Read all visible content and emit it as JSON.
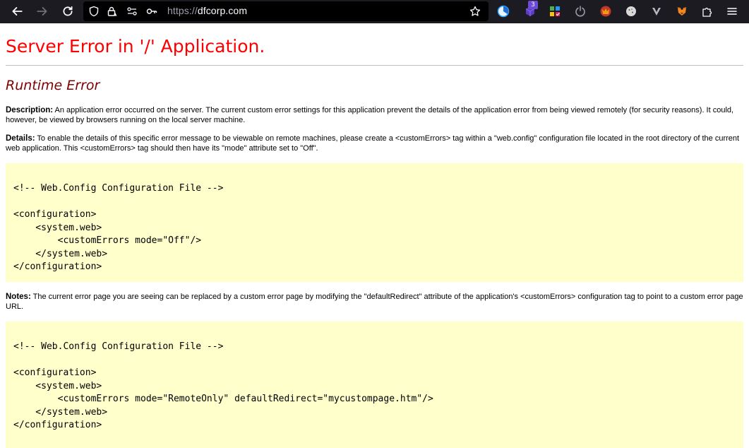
{
  "browser": {
    "url_scheme": "https://",
    "url_host": "dfcorp.com",
    "extension_badge": "3"
  },
  "page": {
    "title": "Server Error in '/' Application.",
    "subtitle": "Runtime Error",
    "description_label": "Description:",
    "description_text": "An application error occurred on the server. The current custom error settings for this application prevent the details of the application error from being viewed remotely (for security reasons). It could, however, be viewed by browsers running on the local server machine.",
    "details_label": "Details:",
    "details_text": "To enable the details of this specific error message to be viewable on remote machines, please create a <customErrors> tag within a \"web.config\" configuration file located in the root directory of the current web application. This <customErrors> tag should then have its \"mode\" attribute set to \"Off\".",
    "code1": "<!-- Web.Config Configuration File -->\n\n<configuration>\n    <system.web>\n        <customErrors mode=\"Off\"/>\n    </system.web>\n</configuration>",
    "notes_label": "Notes:",
    "notes_text": "The current error page you are seeing can be replaced by a custom error page by modifying the \"defaultRedirect\" attribute of the application's <customErrors> configuration tag to point to a custom error page URL.",
    "code2": "<!-- Web.Config Configuration File -->\n\n<configuration>\n    <system.web>\n        <customErrors mode=\"RemoteOnly\" defaultRedirect=\"mycustompage.htm\"/>\n    </system.web>\n</configuration>"
  },
  "colors": {
    "toolbar_bg": "#1c1b22",
    "title_red": "#ff0000",
    "subtitle_maroon": "#800000",
    "code_bg": "#ffffcc"
  }
}
